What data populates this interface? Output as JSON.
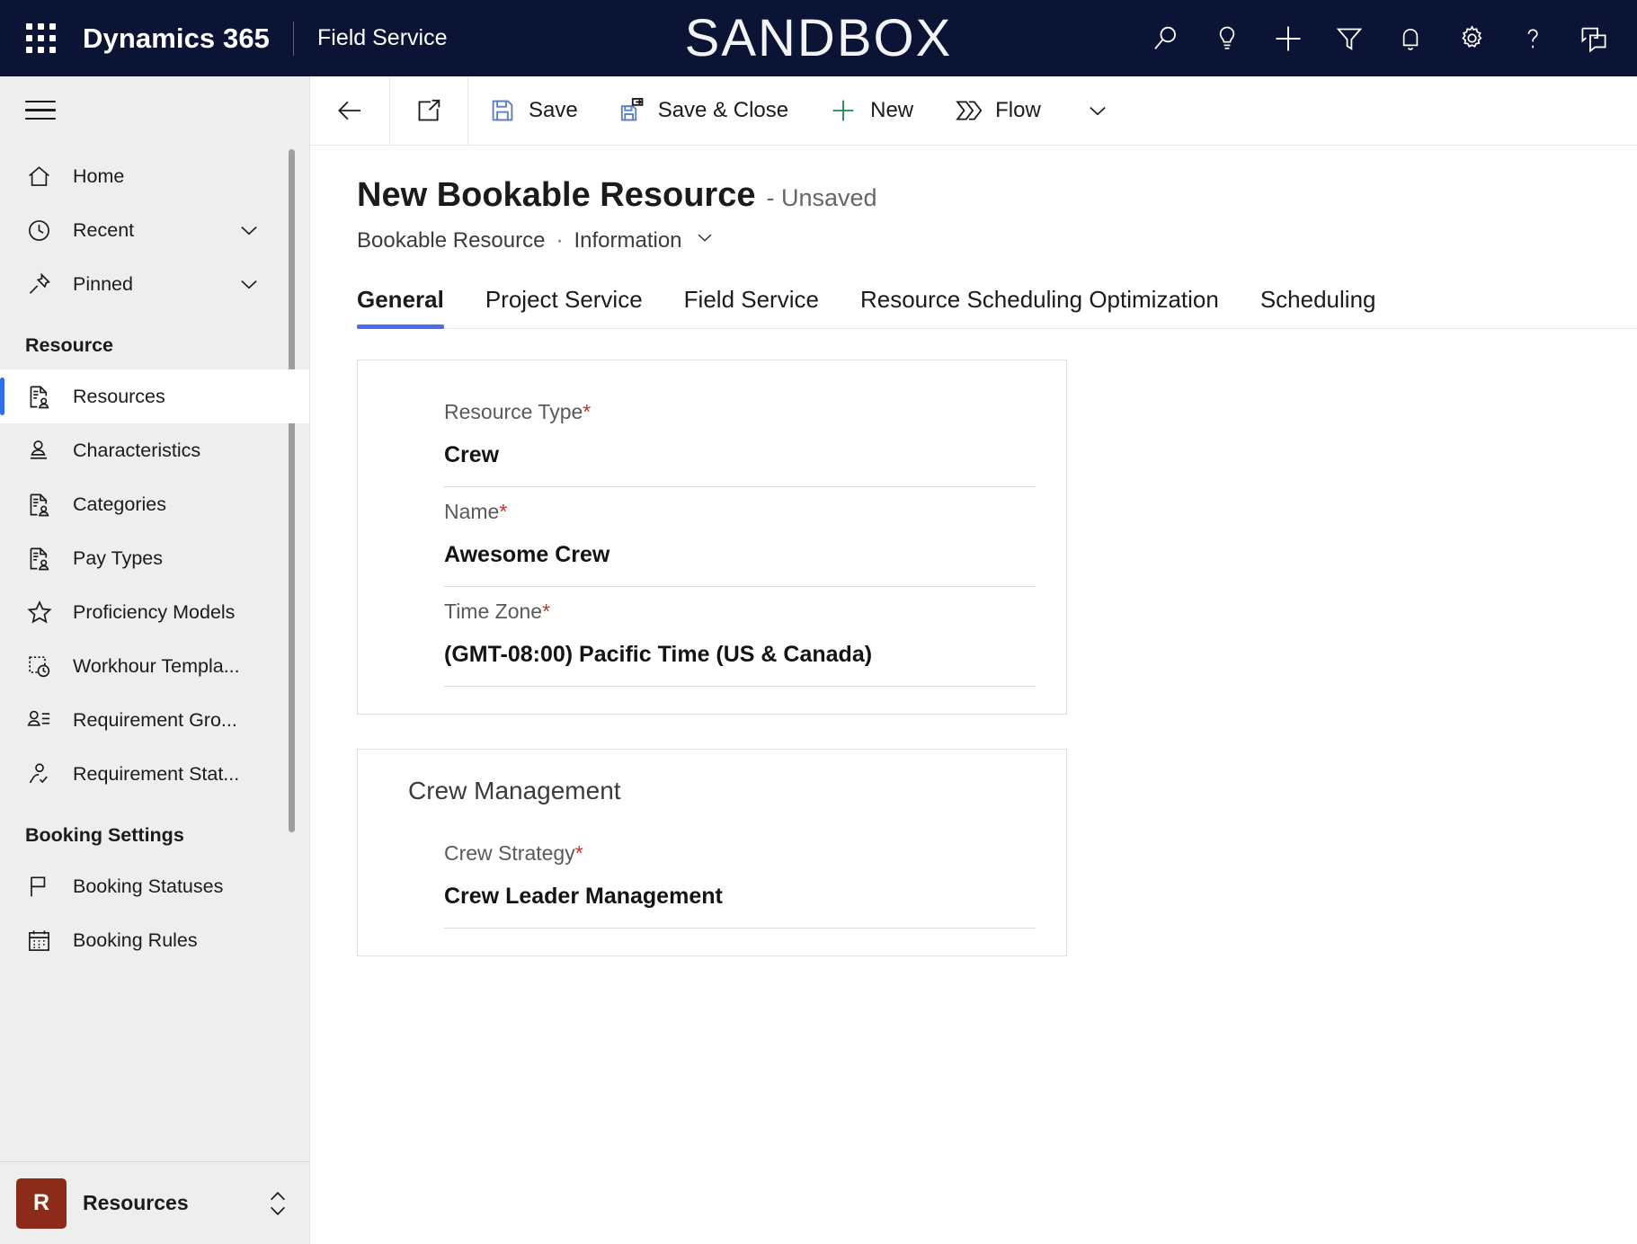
{
  "topbar": {
    "waffle_label": "app-launcher",
    "brand": "Dynamics 365",
    "app_name": "Field Service",
    "environment": "SANDBOX",
    "icons": [
      {
        "name": "search-icon",
        "label": "Search"
      },
      {
        "name": "lightbulb-icon",
        "label": "Relevance Search Insights"
      },
      {
        "name": "plus-icon",
        "label": "Quick Create"
      },
      {
        "name": "filter-icon",
        "label": "Filter"
      },
      {
        "name": "bell-icon",
        "label": "Notifications"
      },
      {
        "name": "gear-icon",
        "label": "Settings"
      },
      {
        "name": "help-icon",
        "label": "Help"
      },
      {
        "name": "feedback-icon",
        "label": "Feedback"
      }
    ]
  },
  "sidebar": {
    "hamburger_label": "Site Map",
    "items": [
      {
        "label": "Home",
        "icon": "home-icon",
        "chevron": false,
        "selected": false
      },
      {
        "label": "Recent",
        "icon": "clock-icon",
        "chevron": true,
        "selected": false
      },
      {
        "label": "Pinned",
        "icon": "pin-icon",
        "chevron": true,
        "selected": false
      }
    ],
    "groups": [
      {
        "title": "Resource",
        "items": [
          {
            "label": "Resources",
            "icon": "document-person-icon",
            "selected": true
          },
          {
            "label": "Characteristics",
            "icon": "person-line-icon",
            "selected": false
          },
          {
            "label": "Categories",
            "icon": "document-person-icon",
            "selected": false
          },
          {
            "label": "Pay Types",
            "icon": "document-person-icon",
            "selected": false
          },
          {
            "label": "Proficiency Models",
            "icon": "star-icon",
            "selected": false
          },
          {
            "label": "Workhour Templa...",
            "icon": "dotted-clock-icon",
            "selected": false
          },
          {
            "label": "Requirement Gro...",
            "icon": "person-list-icon",
            "selected": false
          },
          {
            "label": "Requirement Stat...",
            "icon": "people-check-icon",
            "selected": false
          }
        ]
      },
      {
        "title": "Booking Settings",
        "items": [
          {
            "label": "Booking Statuses",
            "icon": "flag-icon",
            "selected": false
          },
          {
            "label": "Booking Rules",
            "icon": "calendar-icon",
            "selected": false
          }
        ]
      }
    ],
    "footer": {
      "badge": "R",
      "badge_color": "#8d2b1b",
      "label": "Resources",
      "chevron_name": "area-switcher-chevrons"
    }
  },
  "commandbar": {
    "back_label": "Back",
    "popout_label": "Open in new window",
    "save_label": "Save",
    "save_close_label": "Save & Close",
    "new_label": "New",
    "flow_label": "Flow",
    "flow_chevron_label": "More Flow commands"
  },
  "form": {
    "title": "New Bookable Resource",
    "unsaved": "- Unsaved",
    "entity": "Bookable Resource",
    "separator": "·",
    "form_name": "Information",
    "tabs": [
      {
        "label": "General",
        "active": true
      },
      {
        "label": "Project Service",
        "active": false
      },
      {
        "label": "Field Service",
        "active": false
      },
      {
        "label": "Resource Scheduling Optimization",
        "active": false
      },
      {
        "label": "Scheduling",
        "active": false
      }
    ],
    "sections": [
      {
        "title": "",
        "fields": [
          {
            "label": "Resource Type",
            "required": true,
            "value": "Crew"
          },
          {
            "label": "Name",
            "required": true,
            "value": "Awesome Crew"
          },
          {
            "label": "Time Zone",
            "required": true,
            "value": "(GMT-08:00) Pacific Time (US & Canada)"
          }
        ]
      },
      {
        "title": "Crew Management",
        "fields": [
          {
            "label": "Crew Strategy",
            "required": true,
            "value": "Crew Leader Management"
          }
        ]
      }
    ]
  },
  "colors": {
    "navbar_bg": "#0b1435",
    "accent_blue": "#2f6fed",
    "tab_underline": "#4f6bed",
    "required_red": "#c1342b",
    "save_blue": "#5a7fc1",
    "new_green": "#1a8a4a",
    "area_badge": "#8d2b1b"
  }
}
